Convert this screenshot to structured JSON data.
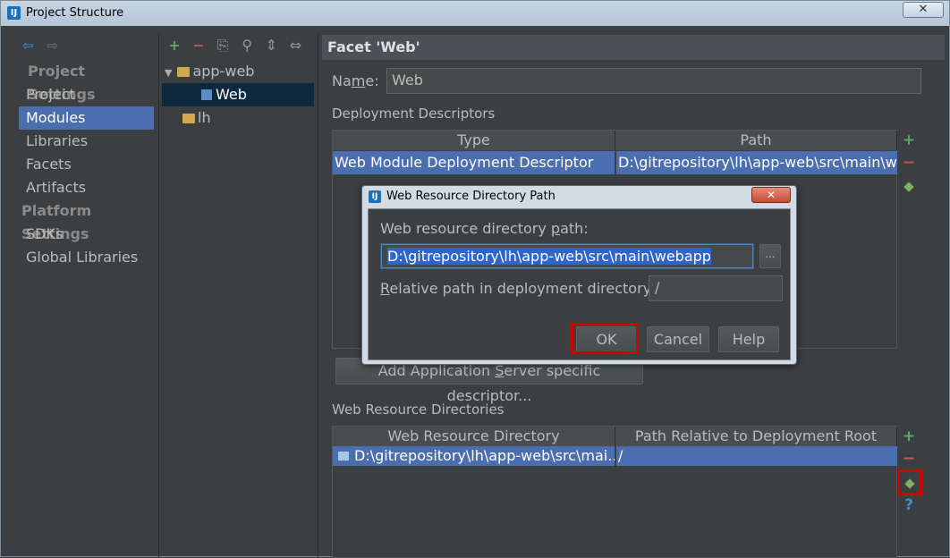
{
  "window": {
    "title": "Project Structure",
    "app_icon": "intellij-icon",
    "close_label": "✕"
  },
  "nav_arrows": {
    "back": "⇦",
    "forward": "⇨"
  },
  "nav": {
    "project_settings_header": "Project Settings",
    "project_items": [
      "Project",
      "Modules",
      "Libraries",
      "Facets",
      "Artifacts"
    ],
    "platform_settings_header": "Platform Settings",
    "platform_items": [
      "SDKs",
      "Global Libraries"
    ],
    "selected": "Modules"
  },
  "tree_toolbar": {
    "add": "+",
    "remove": "−",
    "copy": "⎘",
    "find": "⚲",
    "expand": "⇕",
    "collapse": "⇔"
  },
  "tree": [
    {
      "label": "app-web",
      "icon": "module-folder-icon",
      "level": 0,
      "expanded": "▼"
    },
    {
      "label": "Web",
      "icon": "web-facet-icon",
      "level": 1,
      "selected": true
    },
    {
      "label": "lh",
      "icon": "module-folder-icon",
      "level": 0
    }
  ],
  "facet": {
    "header": "Facet 'Web'",
    "name_label_pre": "Na",
    "name_label_m": "m",
    "name_label_post": "e:",
    "name_value": "Web",
    "deployment_descriptors_label": "Deployment Descriptors",
    "dd_columns": [
      "Type",
      "Path"
    ],
    "dd_rows": [
      {
        "type": "Web Module Deployment Descriptor",
        "path": "D:\\gitrepository\\lh\\app-web\\src\\main\\webapp\\WEB-INF\\web.xml"
      }
    ],
    "add_server_descriptor_pre": "Add Application ",
    "add_server_descriptor_s": "S",
    "add_server_descriptor_post": "erver specific descriptor...",
    "web_resource_dirs_label": "Web Resource Directories",
    "wrd_columns": [
      "Web Resource Directory",
      "Path Relative to Deployment Root"
    ],
    "wrd_rows": [
      {
        "dir": "D:\\gitrepository\\lh\\app-web\\src\\mai...",
        "rel": "/"
      }
    ]
  },
  "side_buttons": {
    "add": "+",
    "remove": "−",
    "help": "?"
  },
  "colors": {
    "accent": "#4b6eaf",
    "highlight_box": "#d40000",
    "add_green": "#59a869",
    "remove_red": "#c75450"
  },
  "dialog": {
    "title": "Web Resource Directory Path",
    "close_label": "✕",
    "path_label_pre": "Web resource directory ",
    "path_label_p": "p",
    "path_label_post": "ath:",
    "path_value": "D:\\gitrepository\\lh\\app-web\\src\\main\\webapp",
    "browse_label": "...",
    "relative_label_pre": "",
    "relative_label_r": "R",
    "relative_label_post": "elative path in deployment directory:",
    "relative_value": "/",
    "ok": "OK",
    "cancel": "Cancel",
    "help": "Help"
  }
}
